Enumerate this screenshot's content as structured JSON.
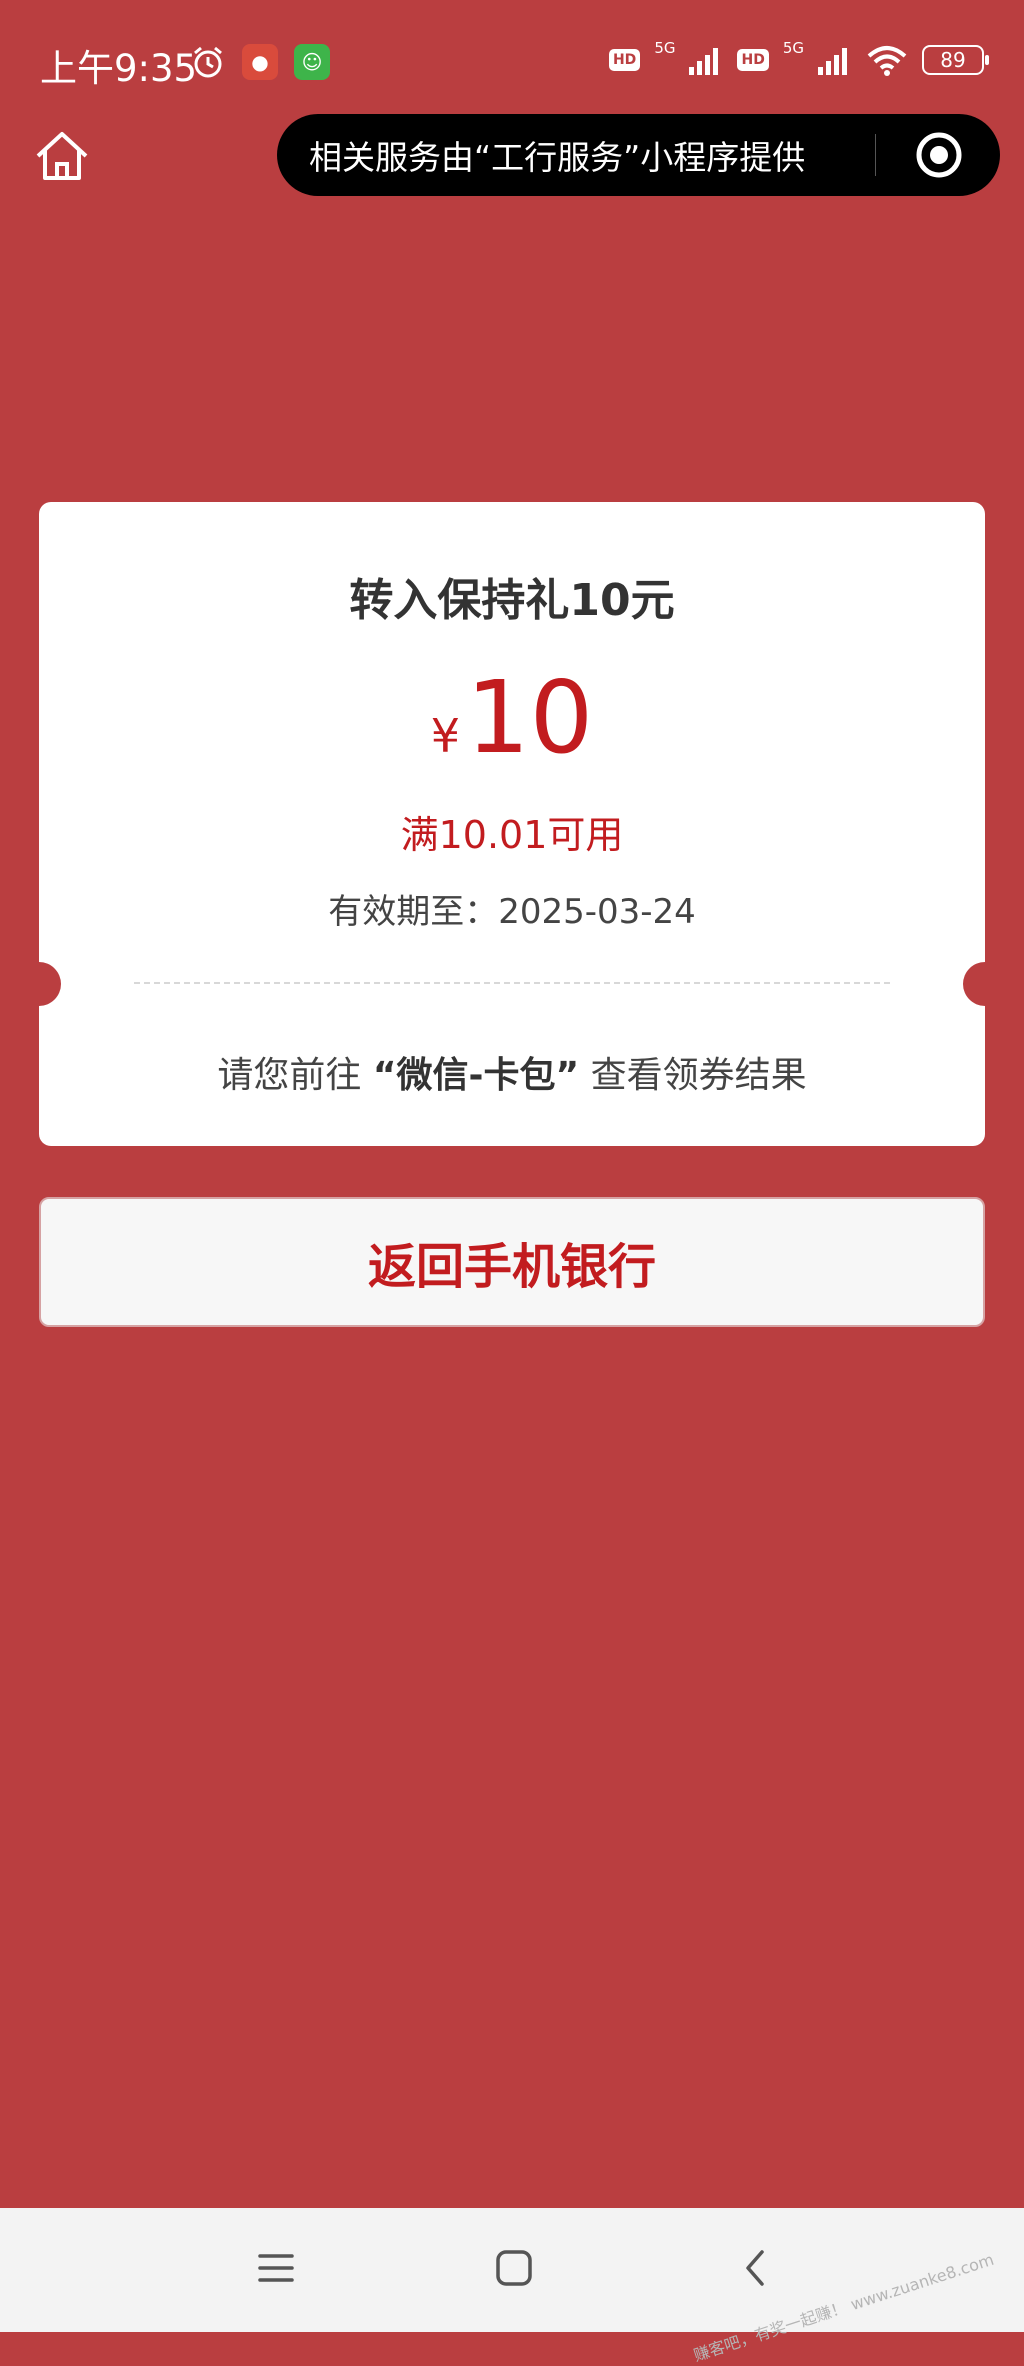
{
  "status_bar": {
    "time": "上午9:35",
    "network_left": "5G",
    "network_right": "5G",
    "hd_label": "HD",
    "battery": "89"
  },
  "nav": {
    "home_icon": "home-icon",
    "capsule_text": "相关服务由“工行服务”小程序提供",
    "capsule_icon": "target-icon"
  },
  "coupon": {
    "title": "转入保持礼10元",
    "currency": "¥",
    "amount": "10",
    "condition": "满10.01可用",
    "validity": "有效期至：2025-03-24",
    "hint_prefix": "请您前往",
    "hint_strong": "“微信-卡包”",
    "hint_suffix": "查看领券结果"
  },
  "actions": {
    "return_label": "返回手机银行"
  },
  "bottom_nav": {
    "menu_icon": "menu-icon",
    "home_icon": "square-home-icon",
    "back_icon": "back-chevron-icon"
  },
  "watermark": "赚客吧，有奖一起赚！ www.zuanke8.com",
  "colors": {
    "background": "#ba3e40",
    "accent_red": "#c21c1f",
    "card": "#ffffff"
  }
}
